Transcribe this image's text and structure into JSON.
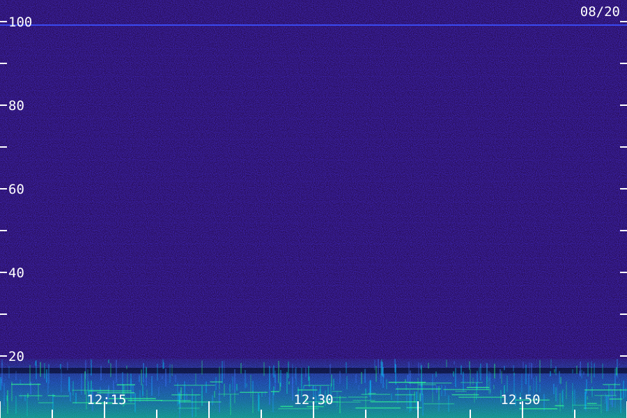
{
  "date_label": "08/20",
  "chart_data": {
    "type": "heatmap",
    "title": "",
    "xlabel": "",
    "ylabel": "",
    "y_tick_labels": [
      "100",
      "80",
      "60",
      "40",
      "20"
    ],
    "y_ticks": [
      100,
      90,
      80,
      70,
      60,
      50,
      40,
      30,
      20
    ],
    "x_tick_labels": [
      "12:15",
      "12:30",
      "12:50"
    ],
    "ylim": [
      0,
      100
    ],
    "colormap": [
      "#000000",
      "#1a0a6e",
      "#3a18c8",
      "#2a5cff",
      "#00c8ff",
      "#20ff80"
    ],
    "background_color": "#2a1060",
    "strong_lines_at": [
      100
    ],
    "low_frequency_activity_below": 20,
    "grid": false
  }
}
